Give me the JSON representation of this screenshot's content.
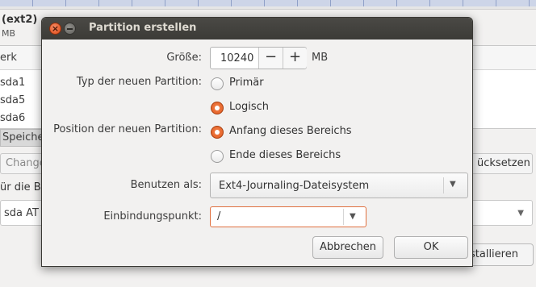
{
  "background": {
    "partition_title": "(ext2)",
    "partition_size_unit": "MB",
    "column_header": "erk",
    "rows": [
      "sda1",
      "sda5",
      "sda6"
    ],
    "storage_label": "Speiche",
    "change_button": "Change",
    "revert_button": "ücksetzen",
    "bootloader_label": "ür die Bo",
    "bootloader_device": "sda   AT",
    "install_button": "stallieren"
  },
  "dialog": {
    "title": "Partition erstellen",
    "size_label": "Größe:",
    "size_value": "10240",
    "size_unit": "MB",
    "minus_glyph": "−",
    "plus_glyph": "+",
    "type_label": "Typ der neuen Partition:",
    "type_options": [
      "Primär",
      "Logisch"
    ],
    "type_selected": "Logisch",
    "position_label": "Position der neuen Partition:",
    "position_options": [
      "Anfang dieses Bereichs",
      "Ende dieses Bereichs"
    ],
    "position_selected": "Anfang dieses Bereichs",
    "use_as_label": "Benutzen als:",
    "use_as_value": "Ext4-Journaling-Dateisystem",
    "mount_label": "Einbindungspunkt:",
    "mount_value": "/",
    "cancel_button": "Abbrechen",
    "ok_button": "OK"
  },
  "icons": {
    "close": "close-icon",
    "minimize": "minimize-icon",
    "dropdown": "chevron-down-icon"
  },
  "colors": {
    "titlebar": "#3c3b37",
    "accent": "#e0551c",
    "window_bg": "#f2f1f0"
  }
}
